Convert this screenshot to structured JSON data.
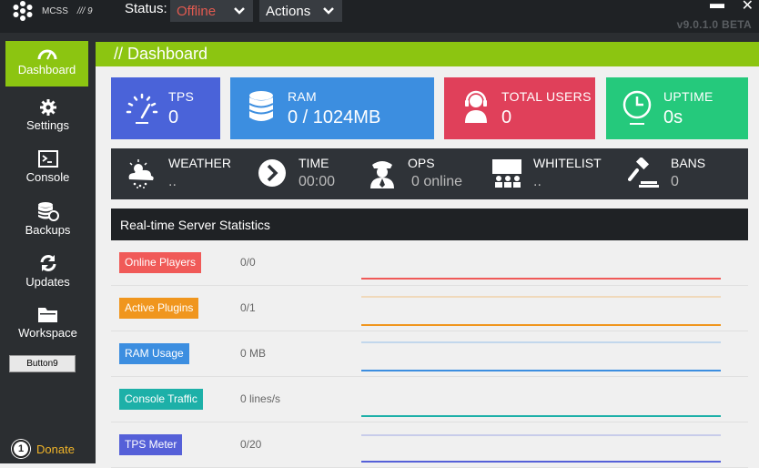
{
  "titlebar": {
    "app_name": "MCSS",
    "app_suffix": "/// 9",
    "status_label": "Status:",
    "status_value": "Offline",
    "actions_label": "Actions",
    "version": "v9.0.1.0 BETA",
    "status_color": "#e05a50"
  },
  "sidebar": {
    "items": [
      {
        "label": "Dashboard",
        "icon": "dashboard-gauge-icon"
      },
      {
        "label": "Settings",
        "icon": "gear-icon"
      },
      {
        "label": "Console",
        "icon": "console-icon"
      },
      {
        "label": "Backups",
        "icon": "database-icon"
      },
      {
        "label": "Updates",
        "icon": "refresh-icon"
      },
      {
        "label": "Workspace",
        "icon": "folder-icon"
      }
    ],
    "button9": "Button9",
    "donate_num": "1",
    "donate_label": "Donate",
    "accent": "#8cc511"
  },
  "header": {
    "title": "// Dashboard"
  },
  "tiles": [
    {
      "title": "TPS",
      "value": "0",
      "color": "#4a63d9",
      "icon": "speedometer-icon"
    },
    {
      "title": "RAM",
      "value": "0 / 1024MB",
      "color": "#3c8ee0",
      "icon": "database-icon"
    },
    {
      "title": "TOTAL USERS",
      "value": "0",
      "color": "#e0405a",
      "icon": "support-agent-icon"
    },
    {
      "title": "UPTIME",
      "value": "0s",
      "color": "#25c97c",
      "icon": "clock-icon"
    }
  ],
  "infobar": [
    {
      "label": "WEATHER",
      "value": "..",
      "icon": "weather-icon"
    },
    {
      "label": "TIME",
      "value": "00:00",
      "icon": "chevron-circle-icon"
    },
    {
      "label": "OPS",
      "value": "0 online",
      "icon": "officer-icon"
    },
    {
      "label": "WHITELIST",
      "value": "..",
      "icon": "whitelist-icon"
    },
    {
      "label": "BANS",
      "value": "0",
      "icon": "gavel-icon"
    }
  ],
  "stats": {
    "title": "Real-time Server Statistics",
    "rows": [
      {
        "label": "Online Players",
        "value": "0/0",
        "color": "#f05a58"
      },
      {
        "label": "Active Plugins",
        "value": "0/1",
        "color": "#f0961e"
      },
      {
        "label": "RAM Usage",
        "value": "0 MB",
        "color": "#3c8ee0"
      },
      {
        "label": "Console Traffic",
        "value": "0 lines/s",
        "color": "#1db0a8"
      },
      {
        "label": "TPS Meter",
        "value": "0/20",
        "color": "#5560d8"
      }
    ]
  }
}
